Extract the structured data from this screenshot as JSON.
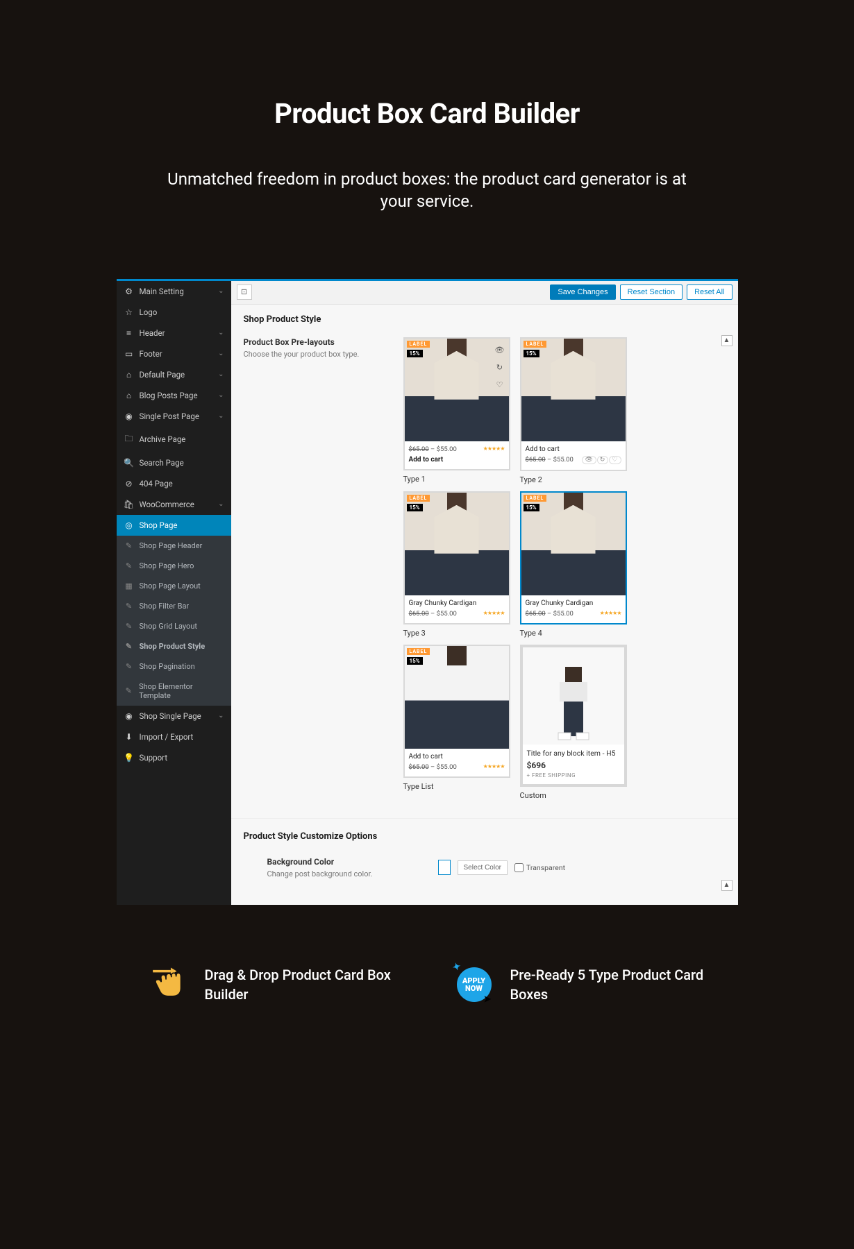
{
  "hero": {
    "title": "Product Box Card Builder",
    "subtitle": "Unmatched freedom in product boxes: the product card generator is at your service."
  },
  "toolbar": {
    "save": "Save Changes",
    "reset_section": "Reset Section",
    "reset_all": "Reset All"
  },
  "sidebar": {
    "items": [
      {
        "icon": "⚙",
        "label": "Main Setting",
        "chev": true
      },
      {
        "icon": "☆",
        "label": "Logo"
      },
      {
        "icon": "≡",
        "label": "Header",
        "chev": true
      },
      {
        "icon": "▭",
        "label": "Footer",
        "chev": true
      },
      {
        "icon": "⌂",
        "label": "Default Page",
        "chev": true
      },
      {
        "icon": "⌂",
        "label": "Blog Posts Page",
        "chev": true
      },
      {
        "icon": "◉",
        "label": "Single Post Page",
        "chev": true
      },
      {
        "icon": "🗀",
        "label": "Archive Page"
      },
      {
        "icon": "🔍",
        "label": "Search Page"
      },
      {
        "icon": "⊘",
        "label": "404 Page"
      },
      {
        "icon": "🛍",
        "label": "WooCommerce",
        "chev": true
      }
    ],
    "shop_page": "Shop Page",
    "shop_subs": [
      "Shop Page Header",
      "Shop Page Hero",
      "Shop Page Layout",
      "Shop Filter Bar",
      "Shop Grid Layout",
      "Shop Product Style",
      "Shop Pagination",
      "Shop Elementor Template"
    ],
    "tail": [
      {
        "icon": "◉",
        "label": "Shop Single Page",
        "chev": true
      },
      {
        "icon": "⬇",
        "label": "Import / Export"
      },
      {
        "icon": "💡",
        "label": "Support"
      }
    ]
  },
  "content": {
    "section_title": "Shop Product Style",
    "prelayouts_title": "Product Box Pre-layouts",
    "prelayouts_sub": "Choose the your product box type.",
    "customize_title": "Product Style Customize Options",
    "bg_title": "Background Color",
    "bg_sub": "Change post background color.",
    "select_color": "Select Color",
    "transparent": "Transparent"
  },
  "card": {
    "label": "LABEL",
    "pct": "15%",
    "old_price": "$65.00",
    "dash": " – ",
    "price": "$55.00",
    "add_to_cart": "Add to cart",
    "prod_name": "Gray Chunky Cardigan",
    "stars": "★★★★★",
    "custom_title": "Title for any block item - H5",
    "custom_price": "$696",
    "custom_ship": "+ FREE SHIPPING"
  },
  "captions": [
    "Type 1",
    "Type 2",
    "Type 3",
    "Type 4",
    "Type List",
    "Custom"
  ],
  "features": {
    "f1": "Drag & Drop Product Card Box Builder",
    "f2": "Pre-Ready 5 Type Product Card Boxes",
    "apply": "APPLY NOW"
  }
}
